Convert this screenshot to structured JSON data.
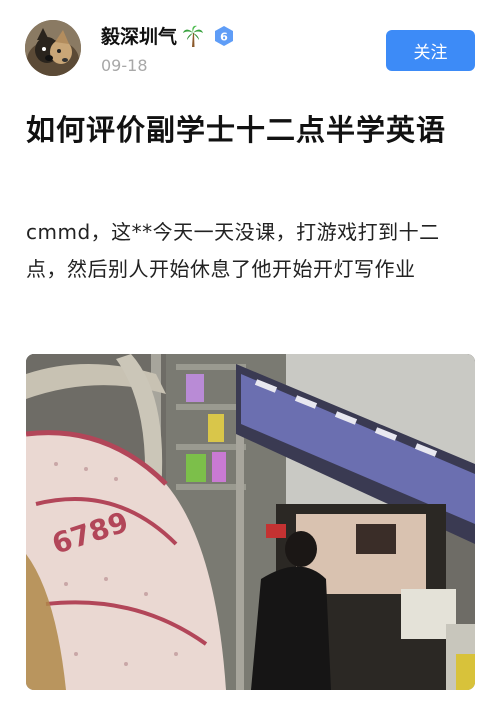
{
  "author": {
    "name": "毅深圳气",
    "level_badge": "6",
    "date": "09-18",
    "avatar_icon": "dog-avatar-icon",
    "emoji_icon": "palm-tree-icon"
  },
  "follow_button": {
    "label": "关注",
    "color": "#3d8bf7"
  },
  "post": {
    "title": "如何评价副学士十二点半学英语",
    "body": "cmmd，这**今天一天没课，打游戏打到十二点，然后别人开始休息了他开始开灯写作业"
  },
  "photo": {
    "subject": "dorm-room-photo",
    "pillow_text": "6789"
  }
}
